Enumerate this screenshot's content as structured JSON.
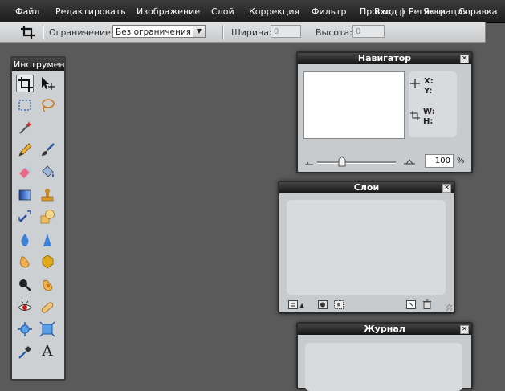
{
  "menu": [
    {
      "label": "Файл"
    },
    {
      "label": "Редактировать"
    },
    {
      "label": "Изображение"
    },
    {
      "label": "Слой"
    },
    {
      "label": "Коррекция"
    },
    {
      "label": "Фильтр"
    },
    {
      "label": "Просмотр"
    },
    {
      "label": "Язык"
    },
    {
      "label": "Справка"
    }
  ],
  "menu_overlay": {
    "login": "Вход",
    "separator": "|",
    "register": "Регистрация"
  },
  "options": {
    "constraint_label": "Ограничение:",
    "constraint_value": "Без ограничения",
    "width_label": "Ширина:",
    "width_value": "0",
    "height_label": "Высота:",
    "height_value": "0"
  },
  "tools_panel": {
    "title": "Инструменты"
  },
  "tools": [
    {
      "name": "crop-tool",
      "icon": "crop-icon",
      "active": true
    },
    {
      "name": "move-tool",
      "icon": "move-icon"
    },
    {
      "name": "marquee-tool",
      "icon": "marquee-icon"
    },
    {
      "name": "lasso-tool",
      "icon": "lasso-icon"
    },
    {
      "name": "wand-tool",
      "icon": "magic-wand-icon"
    },
    {
      "name": "pencil-tool",
      "icon": "pencil-icon"
    },
    {
      "name": "brush-tool",
      "icon": "brush-icon"
    },
    {
      "name": "eraser-tool",
      "icon": "eraser-icon"
    },
    {
      "name": "bucket-tool",
      "icon": "paint-bucket-icon"
    },
    {
      "name": "gradient-tool",
      "icon": "gradient-icon"
    },
    {
      "name": "stamp-tool",
      "icon": "clone-stamp-icon"
    },
    {
      "name": "color-replace-tool",
      "icon": "color-replace-icon"
    },
    {
      "name": "shape-tool",
      "icon": "shape-icon"
    },
    {
      "name": "blur-tool",
      "icon": "blur-icon"
    },
    {
      "name": "sharpen-tool",
      "icon": "sharpen-icon"
    },
    {
      "name": "smudge-tool",
      "icon": "smudge-icon"
    },
    {
      "name": "sponge-tool",
      "icon": "sponge-icon"
    },
    {
      "name": "dodge-tool",
      "icon": "dodge-icon"
    },
    {
      "name": "burn-tool",
      "icon": "burn-icon"
    },
    {
      "name": "redeye-tool",
      "icon": "red-eye-icon"
    },
    {
      "name": "bandage-tool",
      "icon": "bandage-icon"
    },
    {
      "name": "bloat-tool",
      "icon": "bloat-icon"
    },
    {
      "name": "pinch-tool",
      "icon": "pinch-icon"
    },
    {
      "name": "picker-tool",
      "icon": "eyedropper-icon"
    },
    {
      "name": "type-tool",
      "icon": "type-icon",
      "label": "A"
    }
  ],
  "navigator": {
    "title": "Навигатор",
    "close": "✕",
    "x_label": "X:",
    "y_label": "Y:",
    "w_label": "W:",
    "h_label": "H:",
    "zoom_value": "100",
    "zoom_unit": "%"
  },
  "layers": {
    "title": "Слои",
    "close": "✕"
  },
  "history": {
    "title": "Журнал",
    "close": "✕"
  },
  "colors": {
    "menubar": "#1c1c1c",
    "workspace": "#5a5a5a",
    "panel_bg": "#c8cbce",
    "panel_title": "#141414"
  }
}
